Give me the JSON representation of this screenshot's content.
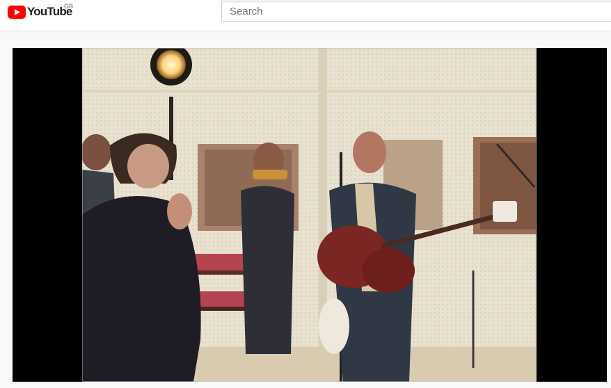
{
  "header": {
    "logo_text": "YouTube",
    "country_code": "GB",
    "search_placeholder": "Search"
  },
  "icons": {
    "logo": "youtube-play-icon"
  },
  "colors": {
    "brand_red": "#ff0000",
    "player_bg": "#000000",
    "page_bg": "#f9f9f9"
  }
}
